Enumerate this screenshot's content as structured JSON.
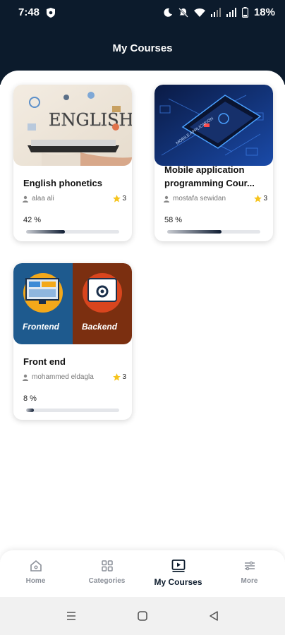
{
  "status": {
    "time": "7:48",
    "battery": "18%"
  },
  "header": {
    "title": "My Courses"
  },
  "courses": [
    {
      "title": "English phonetics",
      "author": "alaa ali",
      "rating": "3",
      "progress_label": "42 %",
      "progress": 0.42
    },
    {
      "title": "Mobile application programming Cour...",
      "author": "mostafa sewidan",
      "rating": "3",
      "progress_label": "58 %",
      "progress": 0.58
    },
    {
      "title": "Front end",
      "author": "mohammed eldagla",
      "rating": "3",
      "progress_label": "8 %",
      "progress": 0.08
    }
  ],
  "thumbs": {
    "english_text": "ENGLISH",
    "mobile_text": "MOBILE APPLICATION",
    "frontend_text": "Frontend",
    "backend_text": "Backend"
  },
  "nav": [
    {
      "label": "Home",
      "icon": "home-icon"
    },
    {
      "label": "Categories",
      "icon": "grid-icon"
    },
    {
      "label": "My Courses",
      "icon": "play-screen-icon",
      "active": true
    },
    {
      "label": "More",
      "icon": "sliders-icon"
    }
  ],
  "colors": {
    "header_bg": "#0c1b2c",
    "progress_fill": "#0f1d33",
    "star": "#f6c41d"
  }
}
